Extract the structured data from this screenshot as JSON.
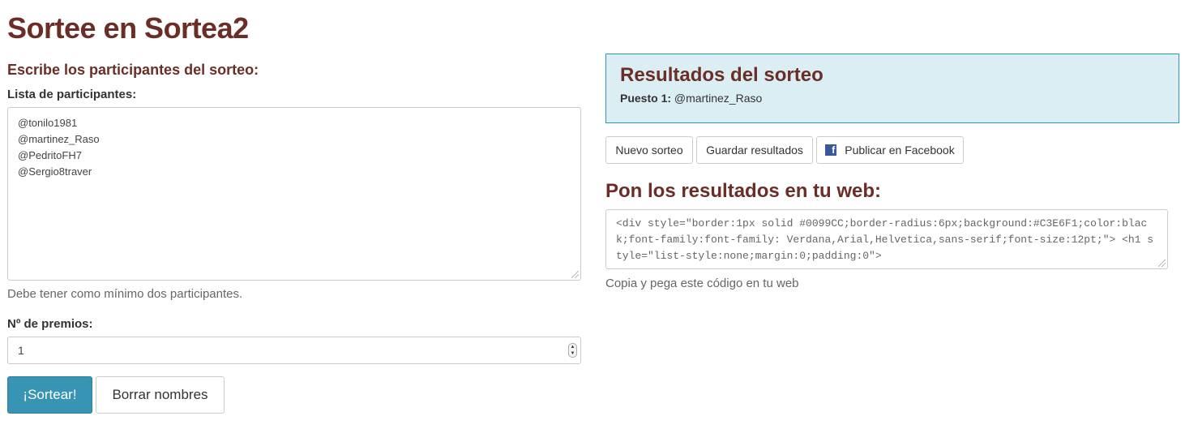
{
  "page": {
    "title": "Sortee en Sortea2"
  },
  "form": {
    "heading": "Escribe los participantes del sorteo:",
    "participants_label": "Lista de participantes:",
    "participants": [
      "@tonilo1981",
      "@martinez_Raso",
      "@PedritoFH7",
      "@Sergio8traver"
    ],
    "participants_help": "Debe tener como mínimo dos participantes.",
    "prizes_label": "Nº de premios:",
    "prizes_value": "1",
    "draw_button": "¡Sortear!",
    "clear_button": "Borrar nombres"
  },
  "results": {
    "title": "Resultados del sorteo",
    "position_label": "Puesto 1:",
    "position_value": "@martinez_Raso",
    "new_button": "Nuevo sorteo",
    "save_button": "Guardar resultados",
    "facebook_button": "Publicar en Facebook"
  },
  "embed": {
    "heading": "Pon los resultados en tu web:",
    "code": "<div style=\"border:1px solid #0099CC;border-radius:6px;background:#C3E6F1;color:black;font-family:font-family: Verdana,Arial,Helvetica,sans-serif;font-size:12pt;\"> <h1 style=\"list-style:none;margin:0;padding:0\">",
    "help": "Copia y pega este código en tu web"
  },
  "colors": {
    "title": "#6b2e26",
    "primary_button": "#3894b5",
    "results_background": "#daeef4",
    "results_border": "#2f93c4"
  }
}
